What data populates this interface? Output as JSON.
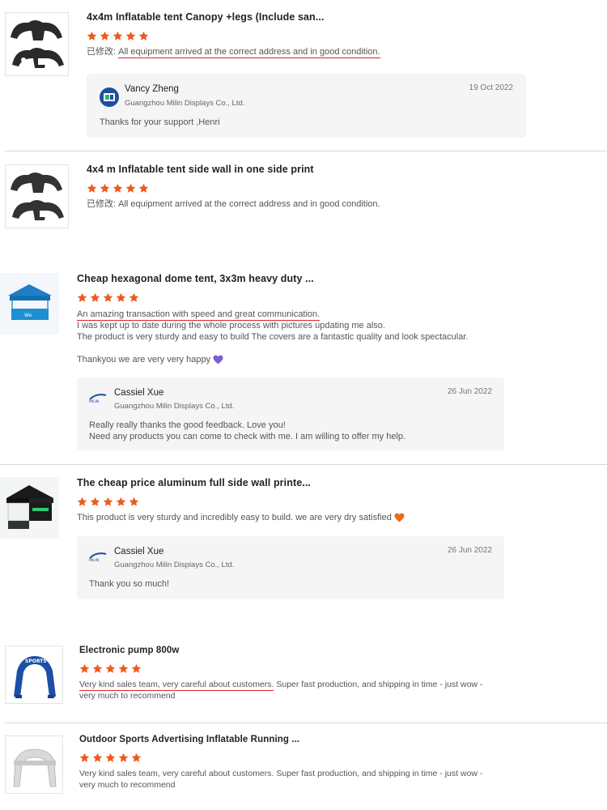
{
  "colors": {
    "star": "#f05a1e",
    "underline": "#d9262c",
    "heart_purple": "#7b5bd6",
    "heart_orange": "#e96b1a"
  },
  "reviews": [
    {
      "title": "4x4m Inflatable tent Canopy +legs (Include san...",
      "rating": 5,
      "prefix": "已修改:",
      "text": "All equipment arrived at the correct address and in good condition.",
      "reply": {
        "name": "Vancy Zheng",
        "company": "Guangzhou Milin Displays Co., Ltd.",
        "date": "19 Oct 2022",
        "text": "Thanks for your support ,Henri"
      }
    },
    {
      "title": "4x4 m Inflatable tent side wall in one side print",
      "rating": 5,
      "prefix": "已修改:",
      "text": "All equipment arrived at the correct address and in good condition."
    },
    {
      "title": "Cheap hexagonal dome tent, 3x3m heavy duty ...",
      "rating": 5,
      "text_line1": "An amazing transaction with speed and great communication.",
      "text_line2": "I was kept up to date during the whole process with pictures updating me also.",
      "text_line3": "The product is very sturdy and easy to build The covers are a fantastic quality and look spectacular.",
      "text_line4": "Thankyou we are very very happy",
      "reply": {
        "name": "Cassiel Xue",
        "company": "Guangzhou Milin Displays Co., Ltd.",
        "date": "26 Jun 2022",
        "text_line1": "Really really thanks the good feedback. Love you!",
        "text_line2": "Need any products you can come to check with me. I am willing to offer my help."
      }
    },
    {
      "title": "The cheap price aluminum full side wall printe...",
      "rating": 5,
      "text": "This product is very sturdy and incredibly easy to build. we are very dry satisfied",
      "reply": {
        "name": "Cassiel Xue",
        "company": "Guangzhou Milin Displays Co., Ltd.",
        "date": "26 Jun 2022",
        "text": "Thank you so much!"
      }
    },
    {
      "title": "Electronic pump 800w",
      "rating": 5,
      "text_underlined": "Very kind sales team, very careful about customers.",
      "text_rest": " Super fast production, and shipping in time - just wow -",
      "text_line2": "very much to recommend"
    },
    {
      "title": "Outdoor Sports Advertising Inflatable Running ...",
      "rating": 5,
      "text_line1": "Very kind sales team, very careful about customers. Super fast production, and shipping in time - just wow -",
      "text_line2": "very much to recommend"
    }
  ]
}
